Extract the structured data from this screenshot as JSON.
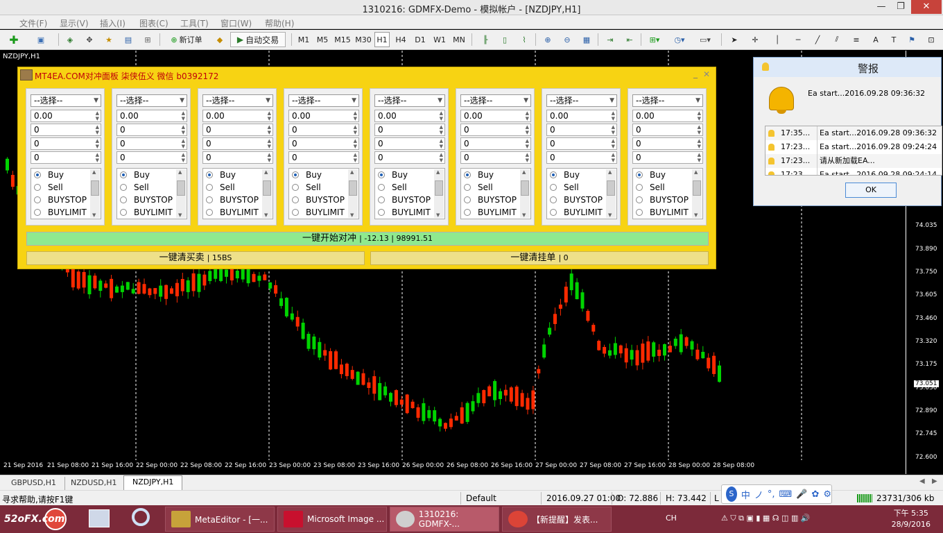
{
  "window": {
    "title": "1310216: GDMFX-Demo - 模拟帐户 - [NZDJPY,H1]",
    "min": "—",
    "restore": "❐",
    "close": "✕"
  },
  "menu": [
    "文件(F)",
    "显示(V)",
    "插入(I)",
    "图表(C)",
    "工具(T)",
    "窗口(W)",
    "帮助(H)"
  ],
  "toolbar": {
    "new_order": "新订单",
    "auto_trade": "自动交易",
    "timeframes": [
      "M1",
      "M5",
      "M15",
      "M30",
      "H1",
      "H4",
      "D1",
      "W1",
      "MN"
    ],
    "active_tf": "H1"
  },
  "chart": {
    "symbol_label": "NZDJPY,H1",
    "price_labels": [
      "74.035",
      "73.890",
      "73.750",
      "73.605",
      "73.460",
      "73.320",
      "73.175",
      "73.030",
      "72.890",
      "72.745",
      "72.600"
    ],
    "current_price": "73.051",
    "time_labels": [
      "21 Sep 2016",
      "21 Sep 08:00",
      "21 Sep 16:00",
      "22 Sep 00:00",
      "22 Sep 08:00",
      "22 Sep 16:00",
      "23 Sep 00:00",
      "23 Sep 08:00",
      "23 Sep 16:00",
      "26 Sep 00:00",
      "26 Sep 08:00",
      "26 Sep 16:00",
      "27 Sep 00:00",
      "27 Sep 08:00",
      "27 Sep 16:00",
      "28 Sep 00:00",
      "28 Sep 08:00"
    ],
    "bull_color": "#00d400",
    "bear_color": "#ff2a00"
  },
  "panel": {
    "title": "MT4EA.COM对冲面板 柒侠伍义 微信 b0392172",
    "min": "_",
    "close": "✕",
    "select_placeholder": "--选择--",
    "columns": [
      {
        "select": "--选择--",
        "lots": "0.00",
        "f1": "0",
        "f2": "0",
        "f3": "0"
      },
      {
        "select": "--选择--",
        "lots": "0.00",
        "f1": "0",
        "f2": "0",
        "f3": "0"
      },
      {
        "select": "--选择--",
        "lots": "0.00",
        "f1": "0",
        "f2": "0",
        "f3": "0"
      },
      {
        "select": "--选择--",
        "lots": "0.00",
        "f1": "0",
        "f2": "0",
        "f3": "0"
      },
      {
        "select": "--选择--",
        "lots": "0.00",
        "f1": "0",
        "f2": "0",
        "f3": "0"
      },
      {
        "select": "--选择--",
        "lots": "0.00",
        "f1": "0",
        "f2": "0",
        "f3": "0"
      },
      {
        "select": "--选择--",
        "lots": "0.00",
        "f1": "0",
        "f2": "0",
        "f3": "0"
      },
      {
        "select": "--选择--",
        "lots": "0.00",
        "f1": "0",
        "f2": "0",
        "f3": "0"
      }
    ],
    "order_types": [
      "Buy",
      "Sell",
      "BUYSTOP",
      "BUYLIMIT"
    ],
    "selected_order_type": "Buy",
    "hedge_label": "一键开始对冲",
    "hedge_stats": "| -12.13 | 98991.51",
    "clear_trades_label": "一键清买卖",
    "clear_trades_stats": "| 15BS",
    "clear_pending_label": "一键清挂单",
    "clear_pending_stats": "| 0"
  },
  "alert": {
    "title": "警报",
    "message": "Ea start...2016.09.28 09:36:32",
    "rows": [
      {
        "time": "17:35...",
        "text": "Ea start...2016.09.28 09:36:32"
      },
      {
        "time": "17:23...",
        "text": "Ea start...2016.09.28 09:24:24"
      },
      {
        "time": "17:23...",
        "text": "请从新加载EA..."
      },
      {
        "time": "17:23...",
        "text": "Ea start...2016.09.28 09:24:14"
      }
    ],
    "ok": "OK"
  },
  "tabs": [
    "GBPUSD,H1",
    "NZDUSD,H1",
    "NZDJPY,H1"
  ],
  "active_tab": "NZDJPY,H1",
  "status": {
    "help": "寻求帮助,请按F1键",
    "profile": "Default",
    "datetime": "2016.09.27 01:00",
    "open": "O: 72.886",
    "high": "H: 73.442",
    "low_prefix": "L",
    "traffic": "23731/306 kb"
  },
  "ime": {
    "label": "中",
    "chars": [
      "ノ",
      "°,",
      "⌨",
      "🎤",
      "✿",
      "⚙"
    ]
  },
  "taskbar": {
    "watermark": "52oFX.com",
    "items": [
      {
        "label": "MetaEditor - [一...",
        "color": "#c7a23a"
      },
      {
        "label": "Microsoft Image ...",
        "color": "#c8102e"
      },
      {
        "label": "1310216: GDMFX-...",
        "color": "#cfcfcf"
      },
      {
        "label": "【新提醒】发表...",
        "color": "#db4437"
      }
    ],
    "tray_lang": "CH",
    "time": "下午 5:35",
    "date": "28/9/2016"
  }
}
